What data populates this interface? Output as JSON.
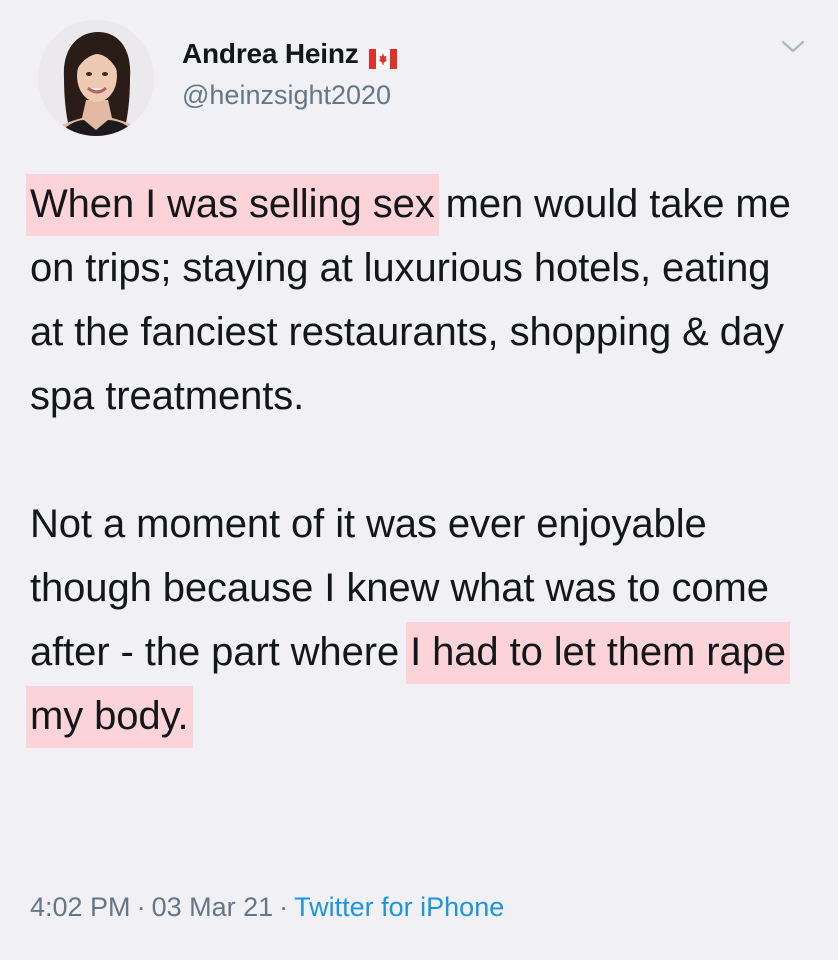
{
  "author": {
    "display_name": "Andrea Heinz",
    "handle": "@heinzsight2020",
    "flag_icon": "canada-flag-icon",
    "avatar_icon": "profile-photo"
  },
  "menu": {
    "icon": "chevron-down-icon"
  },
  "tweet": {
    "p1_highlight": "When I was selling sex",
    "p1_rest": " men would take me on trips; staying at luxurious hotels, eating at the fanciest restaurants, shopping & day spa treatments.",
    "p2_start": "Not a moment of it was ever enjoyable though because I knew what was to come after - the part where ",
    "p2_highlight": "I had to let them rape my body."
  },
  "meta": {
    "time": "4:02 PM",
    "separator": "·",
    "date": "03 Mar 21",
    "source": "Twitter for iPhone"
  },
  "colors": {
    "background": "#f1f0f4",
    "highlight": "#fbd3d9",
    "link": "#1b95e0",
    "secondary_text": "#657786"
  }
}
